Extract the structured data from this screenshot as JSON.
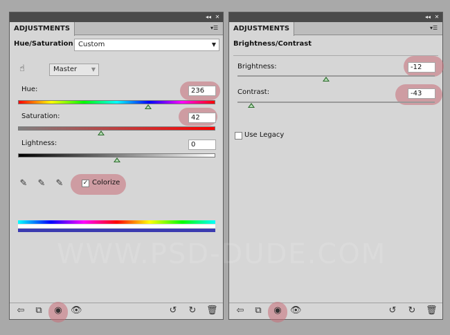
{
  "left_panel": {
    "tab_label": "ADJUSTMENTS",
    "title": "Hue/Saturation",
    "preset_value": "Custom",
    "channel_value": "Master",
    "hue_label": "Hue:",
    "hue_value": "236",
    "hue_level": 0.66,
    "saturation_label": "Saturation:",
    "saturation_value": "42",
    "saturation_level": 0.42,
    "lightness_label": "Lightness:",
    "lightness_value": "0",
    "lightness_level": 0.5,
    "colorize_label": "Colorize",
    "colorize_checked": true
  },
  "right_panel": {
    "tab_label": "ADJUSTMENTS",
    "title": "Brightness/Contrast",
    "brightness_label": "Brightness:",
    "brightness_value": "-12",
    "brightness_level": 0.45,
    "contrast_label": "Contrast:",
    "contrast_value": "-43",
    "contrast_level": 0.07,
    "legacy_label": "Use Legacy"
  },
  "watermark": "WWW.PSD-DUDE.COM",
  "colors": {
    "highlight": "#c86e78",
    "panel_bg": "#d6d6d6",
    "thumb": "#2a6a2a"
  },
  "icons": [
    "back-arrow-icon",
    "clip-to-layer-icon",
    "visibility-eye-icon",
    "previous-state-icon",
    "reset-icon",
    "delete-icon",
    "targeted-adjustment-icon",
    "eyedropper-icon"
  ]
}
